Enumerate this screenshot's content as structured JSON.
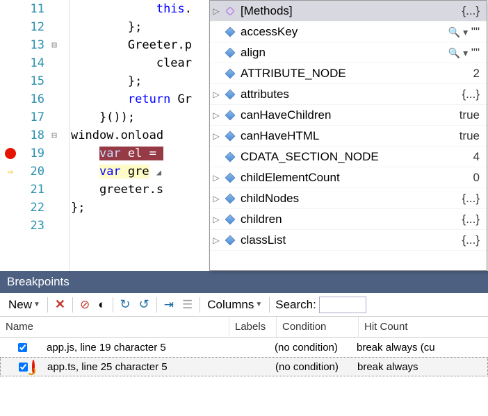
{
  "editor": {
    "lines": [
      {
        "n": 11,
        "code": "            this."
      },
      {
        "n": 12,
        "code": "        };"
      },
      {
        "n": 13,
        "code": "        Greeter.p",
        "fold": "⊟"
      },
      {
        "n": 14,
        "code": "            clear"
      },
      {
        "n": 15,
        "code": "        };"
      },
      {
        "n": 16,
        "code": "        return Gr",
        "kw": "return"
      },
      {
        "n": 17,
        "code": "    }());"
      },
      {
        "n": 18,
        "code": "window.onload",
        "fold": "⊟"
      },
      {
        "n": 19,
        "code": "    var el = ",
        "glyph": "bp",
        "hl": "red",
        "kw": "var"
      },
      {
        "n": 20,
        "code": "    var gre",
        "glyph": "arrow",
        "hl": "yel",
        "kw": "var"
      },
      {
        "n": 21,
        "code": "    greeter.s"
      },
      {
        "n": 22,
        "code": "};"
      },
      {
        "n": 23,
        "code": ""
      }
    ]
  },
  "autocomplete": {
    "items": [
      {
        "label": "[Methods]",
        "val": "{...}",
        "sel": true,
        "exp": "▷",
        "icon": "method"
      },
      {
        "label": "accessKey",
        "val": "\"\"",
        "mag": true,
        "icon": "cube"
      },
      {
        "label": "align",
        "val": "\"\"",
        "mag": true,
        "icon": "cube"
      },
      {
        "label": "ATTRIBUTE_NODE",
        "val": "2",
        "icon": "cube"
      },
      {
        "label": "attributes",
        "val": "{...}",
        "exp": "▷",
        "icon": "cube"
      },
      {
        "label": "canHaveChildren",
        "val": "true",
        "exp": "▷",
        "icon": "cube"
      },
      {
        "label": "canHaveHTML",
        "val": "true",
        "exp": "▷",
        "icon": "cube"
      },
      {
        "label": "CDATA_SECTION_NODE",
        "val": "4",
        "icon": "cube"
      },
      {
        "label": "childElementCount",
        "val": "0",
        "exp": "▷",
        "icon": "cube"
      },
      {
        "label": "childNodes",
        "val": "{...}",
        "exp": "▷",
        "icon": "cube"
      },
      {
        "label": "children",
        "val": "{...}",
        "exp": "▷",
        "icon": "cube"
      },
      {
        "label": "classList",
        "val": "{...}",
        "exp": "▷",
        "icon": "cube"
      }
    ]
  },
  "breakpoints": {
    "title": "Breakpoints",
    "toolbar": {
      "new": "New",
      "columns": "Columns",
      "search": "Search:"
    },
    "cols": {
      "name": "Name",
      "labels": "Labels",
      "condition": "Condition",
      "hit": "Hit Count"
    },
    "rows": [
      {
        "name": "app.js, line 19 character 5",
        "cond": "(no condition)",
        "hit": "break always (cu",
        "icon": "solid"
      },
      {
        "name": "app.ts, line 25 character 5",
        "cond": "(no condition)",
        "hit": "break always",
        "icon": "ring"
      }
    ]
  }
}
